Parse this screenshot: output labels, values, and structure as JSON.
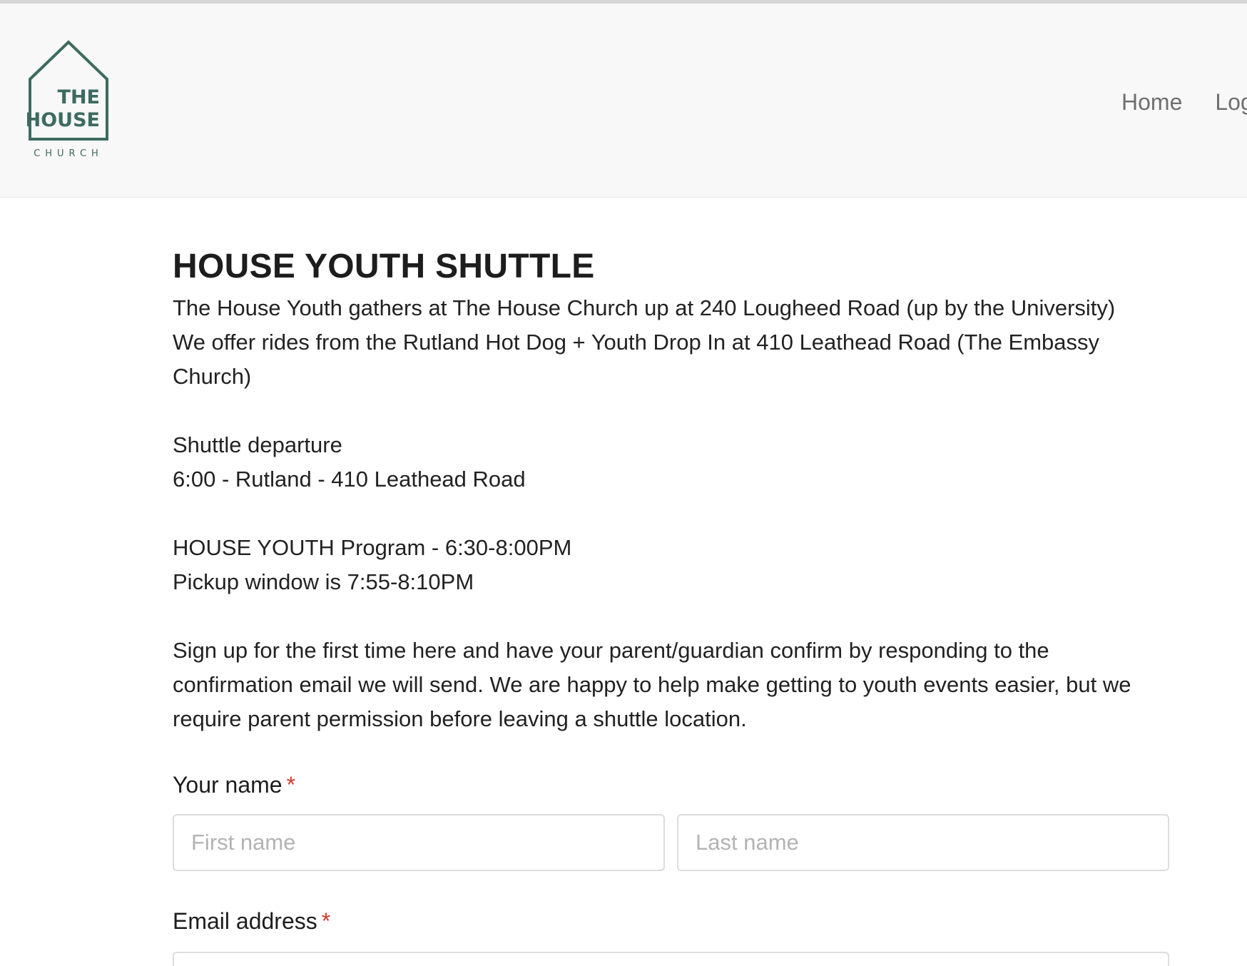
{
  "logo": {
    "line1": "THE",
    "line2": "HOUSE",
    "line3": "CHURCH",
    "color": "#3d6b5f"
  },
  "nav": {
    "home": "Home",
    "login": "Log"
  },
  "page": {
    "title": "HOUSE YOUTH SHUTTLE",
    "intro_line1": "The House Youth gathers at The House Church up at 240 Lougheed Road (up by the University)",
    "intro_line2": "We offer rides from the Rutland Hot Dog + Youth Drop In at 410 Leathead Road (The Embassy Church)",
    "departure_heading": "Shuttle departure",
    "departure_time": "6:00 - Rutland - 410 Leathead Road",
    "program_time": "HOUSE YOUTH Program - 6:30-8:00PM",
    "pickup_window": "Pickup window is 7:55-8:10PM",
    "signup_text": "Sign up for the first time here and have your parent/guardian confirm by responding to the confirmation email we will send. We are happy to help make getting to youth events easier, but we require parent permission before leaving a shuttle location."
  },
  "form": {
    "name_label": "Your name",
    "required_mark": "*",
    "first_name_placeholder": "First name",
    "last_name_placeholder": "Last name",
    "email_label": "Email address"
  }
}
